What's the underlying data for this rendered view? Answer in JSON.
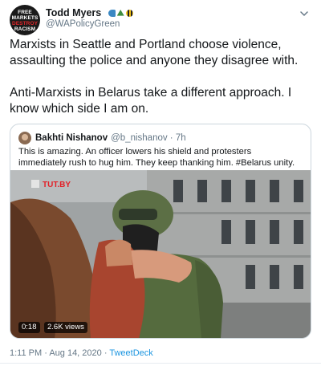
{
  "tweet": {
    "author_name": "Todd Myers",
    "author_handle": "@WAPolicyGreen",
    "avatar_text": [
      "FREE",
      "MARKETS",
      "DESTROY",
      "RACISM"
    ],
    "emoji": [
      "fish-emoji",
      "tree-emoji",
      "bee-emoji"
    ],
    "text": "Marxists in Seattle and Portland choose violence, assaulting the police and anyone they disagree with.\n\nAnti-Marxists in Belarus take a different approach. I know which side I am on.",
    "timestamp": "1:11 PM · Aug 14, 2020 · ",
    "source": "TweetDeck"
  },
  "quoted": {
    "name": "Bakhti Nishanov",
    "handle_time": "@b_nishanov · 7h",
    "text": "This is amazing. An officer lowers his shield and protesters immediately rush to hug him. They keep thanking him. #Belarus unity.",
    "video": {
      "duration": "0:18",
      "views": "2.6K views",
      "watermark": "TUT.BY"
    }
  },
  "colors": {
    "link": "#1b95e0",
    "secondary_text": "#657786",
    "border": "#ccd6dd"
  }
}
